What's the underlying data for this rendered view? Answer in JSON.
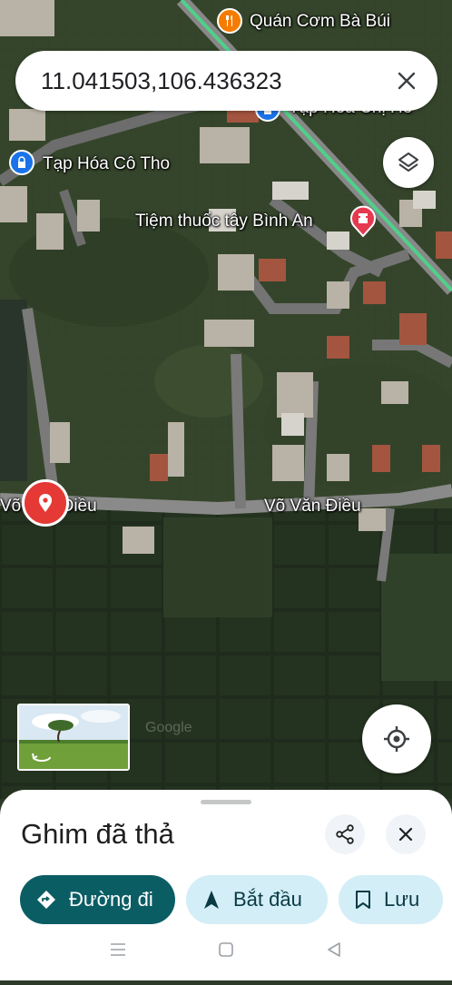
{
  "search": {
    "value": "11.041503,106.436323"
  },
  "map": {
    "labels": {
      "quan_com": "Quán Cơm Bà Búi",
      "tap_hoa_chi_he": "Tạp Hóa Chị Hè",
      "tap_hoa_co_tho": "Tạp Hóa Cô Tho",
      "tiem_thuoc": "Tiệm thuốc tây Bình An",
      "road_left": "Võ Văn Điều",
      "road_right": "Võ Văn Điều"
    },
    "watermark": "Google",
    "colors": {
      "pin": "#e53935",
      "poi_food": "#f57c00",
      "poi_shop": "#1a73e8",
      "pharmacy": "#e53950",
      "highway": "#4fd08a"
    }
  },
  "sheet": {
    "title": "Ghim đã thả",
    "directions_label": "Đường đi",
    "start_label": "Bắt đầu",
    "save_label": "Lưu"
  },
  "icons": [
    "close-icon",
    "layers-icon",
    "my-location-icon",
    "share-icon",
    "directions-icon",
    "navigation-icon",
    "bookmark-icon",
    "map-pin-icon",
    "store-icon",
    "restaurant-icon",
    "pharmacy-icon",
    "streetview-icon"
  ]
}
